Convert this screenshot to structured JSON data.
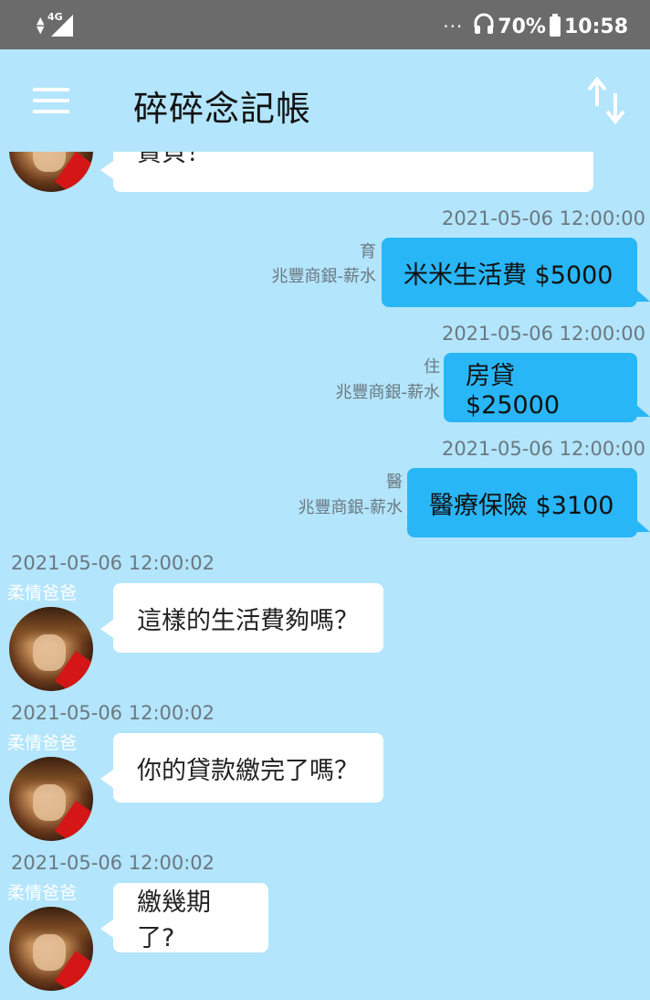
{
  "status_bar": {
    "network": "4G",
    "dots": "···",
    "battery_pct": "70%",
    "time": "10:58",
    "icons": [
      "signal-icon",
      "headphones-icon",
      "battery-icon"
    ]
  },
  "app_bar": {
    "title": "碎碎念記帳",
    "menu_icon": "hamburger-menu-icon",
    "sort_icon": "sort-arrows-icon"
  },
  "messages": {
    "partial_top": {
      "text": "貸貝！"
    },
    "out": [
      {
        "timestamp": "2021-05-06 12:00:00",
        "category": "育",
        "account": "兆豐商銀-薪水",
        "text": "米米生活費 $5000"
      },
      {
        "timestamp": "2021-05-06 12:00:00",
        "category": "住",
        "account": "兆豐商銀-薪水",
        "text": "房貸 $25000"
      },
      {
        "timestamp": "2021-05-06 12:00:00",
        "category": "醫",
        "account": "兆豐商銀-薪水",
        "text": "醫療保險 $3100"
      }
    ],
    "in": [
      {
        "timestamp": "2021-05-06 12:00:02",
        "sender": "柔情爸爸",
        "text": "這樣的生活費夠嗎？"
      },
      {
        "timestamp": "2021-05-06 12:00:02",
        "sender": "柔情爸爸",
        "text": "你的貸款繳完了嗎？"
      },
      {
        "timestamp": "2021-05-06 12:00:02",
        "sender": "柔情爸爸",
        "text": "繳幾期了?"
      }
    ]
  },
  "colors": {
    "background": "#b3e5fc",
    "status_bar": "#6b6b6b",
    "outgoing_bubble": "#29b6f6",
    "incoming_bubble": "#ffffff"
  }
}
